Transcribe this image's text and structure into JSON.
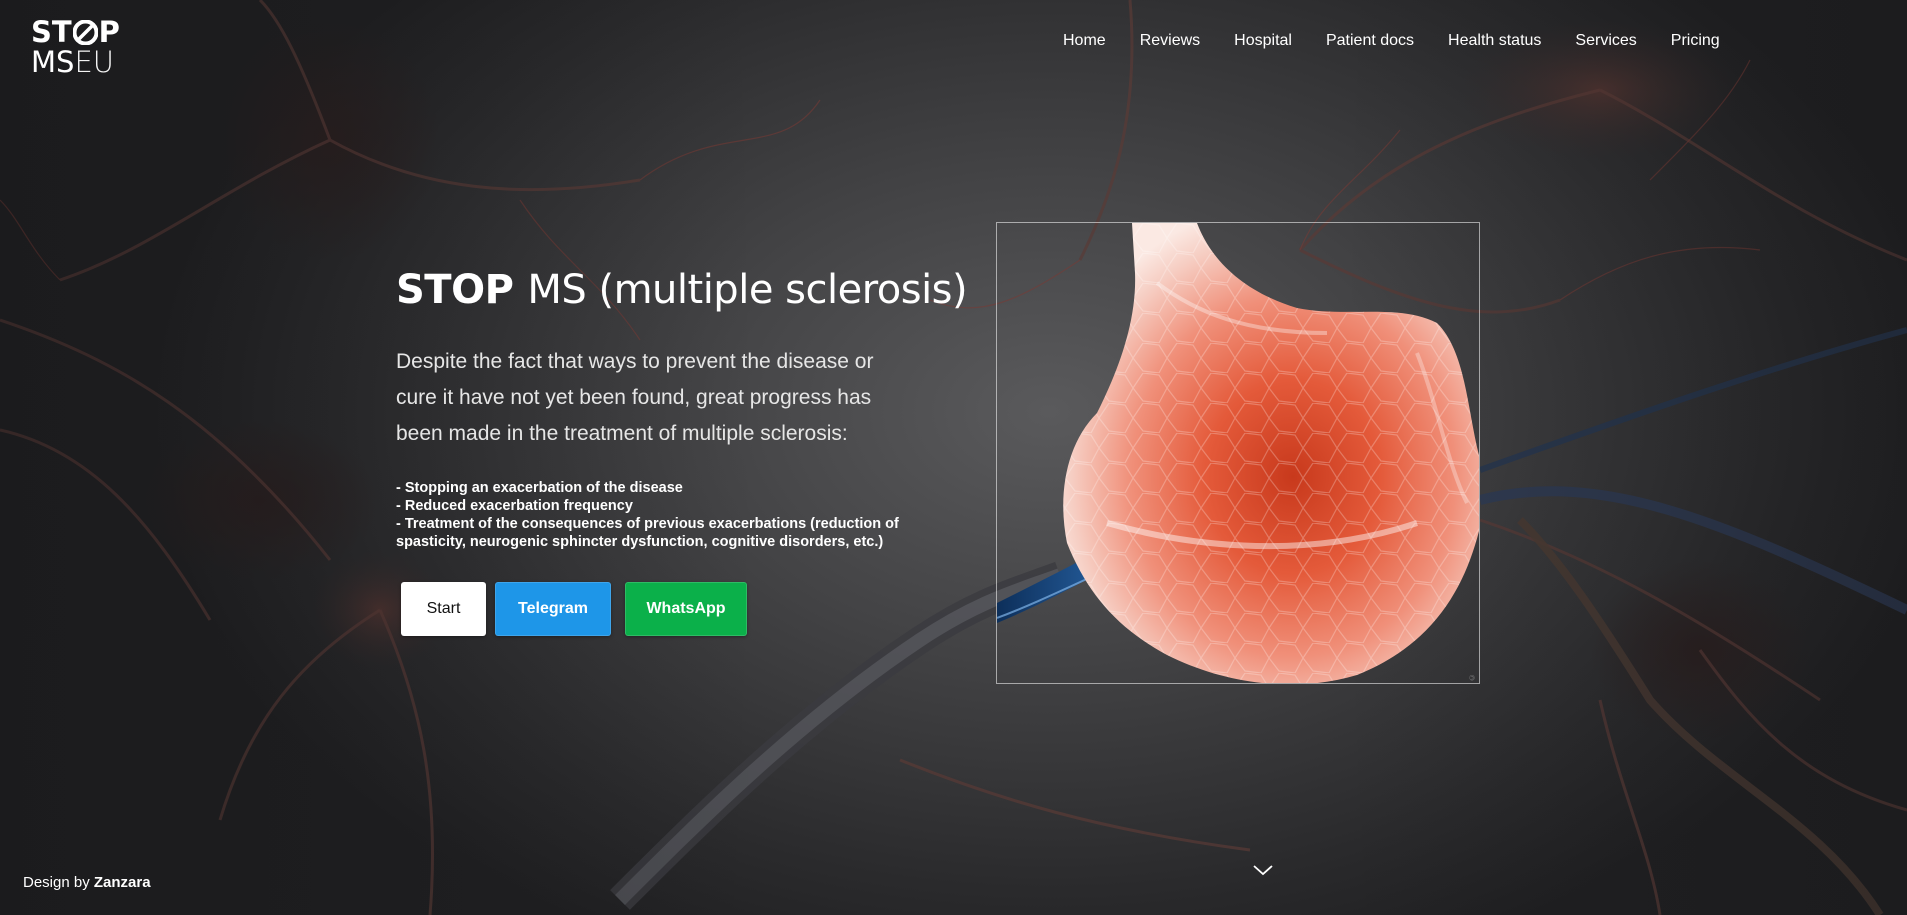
{
  "logo": {
    "line1": "STOP",
    "line1_left": "ST",
    "line1_right": "P",
    "ms": "MS",
    "eu": "EU"
  },
  "nav": {
    "items": [
      {
        "label": "Home"
      },
      {
        "label": "Reviews"
      },
      {
        "label": "Hospital"
      },
      {
        "label": "Patient docs"
      },
      {
        "label": "Health status"
      },
      {
        "label": "Services"
      },
      {
        "label": "Pricing"
      }
    ]
  },
  "hero": {
    "title_strong": "STOP",
    "title_rest": "MS (multiple sclerosis)",
    "description": "Despite the fact that ways to prevent the disease or cure it have not yet been found, great progress has been made in the treatment of multiple sclerosis:",
    "points": [
      "- Stopping an exacerbation of the disease",
      "- Reduced exacerbation frequency",
      "- Treatment of the consequences of previous exacerbations (reduction of spasticity, neurogenic sphincter dysfunction, cognitive disorders, etc.)"
    ]
  },
  "buttons": {
    "start": "Start",
    "telegram": "Telegram",
    "whatsapp": "WhatsApp"
  },
  "footer": {
    "credit_prefix": "Design by",
    "credit_author": "Zanzara"
  },
  "icons": {
    "scroll": "chevron-down-icon",
    "logo_o": "stop-sign-o-icon"
  },
  "colors": {
    "telegram": "#1e96e8",
    "whatsapp": "#0bb04a",
    "start_bg": "#ffffff"
  }
}
